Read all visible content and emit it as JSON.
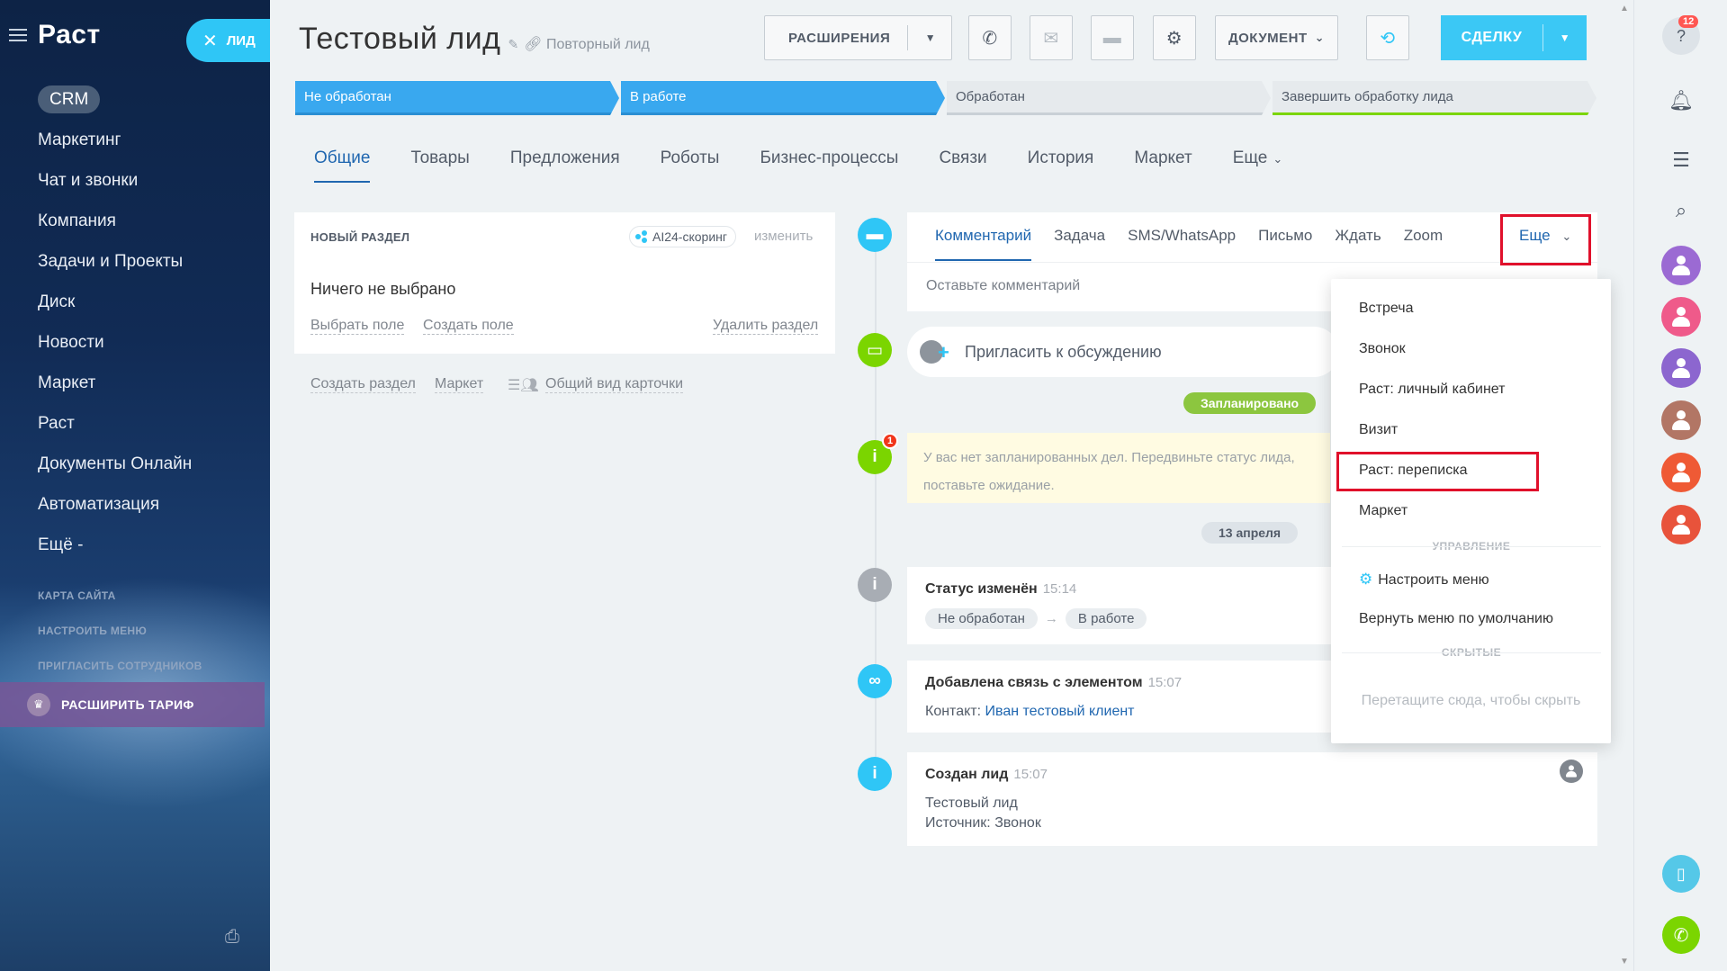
{
  "sidebar": {
    "brand": "Раст",
    "items": [
      {
        "label": "CRM"
      },
      {
        "label": "Маркетинг"
      },
      {
        "label": "Чат и звонки"
      },
      {
        "label": "Компания"
      },
      {
        "label": "Задачи и Проекты"
      },
      {
        "label": "Диск"
      },
      {
        "label": "Новости"
      },
      {
        "label": "Маркет"
      },
      {
        "label": "Раст"
      },
      {
        "label": "Документы Онлайн"
      },
      {
        "label": "Автоматизация"
      },
      {
        "label": "Ещё -"
      }
    ],
    "site_map": "КАРТА САЙТА",
    "setup_menu": "НАСТРОИТЬ МЕНЮ",
    "invite": "ПРИГЛАСИТЬ СОТРУДНИКОВ",
    "upgrade": "РАСШИРИТЬ ТАРИФ"
  },
  "close_tab": {
    "label": "ЛИД"
  },
  "header": {
    "title": "Тестовый лид",
    "repeat_label": "Повторный лид",
    "extensions": "РАСШИРЕНИЯ",
    "document": "ДОКУМЕНТ",
    "deal": "СДЕЛКУ"
  },
  "stages": [
    {
      "label": "Не обработан"
    },
    {
      "label": "В работе"
    },
    {
      "label": "Обработан"
    },
    {
      "label": "Завершить обработку лида"
    }
  ],
  "tabs": [
    {
      "label": "Общие"
    },
    {
      "label": "Товары"
    },
    {
      "label": "Предложения"
    },
    {
      "label": "Роботы"
    },
    {
      "label": "Бизнес-процессы"
    },
    {
      "label": "Связи"
    },
    {
      "label": "История"
    },
    {
      "label": "Маркет"
    },
    {
      "label": "Еще"
    }
  ],
  "card": {
    "heading": "НОВЫЙ РАЗДЕЛ",
    "ai_chip": "AI24-скоринг",
    "edit": "изменить",
    "empty": "Ничего не выбрано",
    "select_field": "Выбрать поле",
    "create_field": "Создать поле",
    "delete_section": "Удалить раздел"
  },
  "below_card": {
    "create_section": "Создать раздел",
    "market": "Маркет",
    "card_view": "Общий вид карточки"
  },
  "editor": {
    "tabs": [
      "Комментарий",
      "Задача",
      "SMS/WhatsApp",
      "Письмо",
      "Ждать",
      "Zoom"
    ],
    "more": "Еще",
    "placeholder": "Оставьте комментарий"
  },
  "invite": {
    "label": "Пригласить к обсуждению"
  },
  "timeline": {
    "scheduled": "Запланировано",
    "warning_line1": "У вас нет запланированных дел. Передвиньте статус лида,",
    "warning_line2": "поставьте ожидание.",
    "warning_count": "1",
    "date": "13 апреля",
    "status": {
      "title": "Статус изменён",
      "time": "15:14",
      "from": "Не обработан",
      "to": "В работе"
    },
    "link": {
      "title": "Добавлена связь с элементом",
      "time": "15:07",
      "prefix": "Контакт:",
      "contact": "Иван тестовый клиент"
    },
    "created": {
      "title": "Создан лид",
      "time": "15:07",
      "line1": "Тестовый лид",
      "line2": "Источник: Звонок"
    }
  },
  "dropdown": {
    "items": [
      "Встреча",
      "Звонок",
      "Раст: личный кабинет",
      "Визит",
      "Раст: переписка",
      "Маркет"
    ],
    "section_manage": "УПРАВЛЕНИЕ",
    "configure": "Настроить меню",
    "reset": "Вернуть меню по умолчанию",
    "section_hidden": "СКРЫТЫЕ",
    "drop_hint": "Перетащите сюда, чтобы скрыть"
  },
  "rail": {
    "help_badge": "12"
  },
  "colors": {
    "accent": "#2fc6f6",
    "stage_blue": "#39a8ef",
    "link": "#2067b0",
    "green": "#7bd500",
    "highlight_red": "#e0102b",
    "avatars": [
      "#9b6ad3",
      "#ef5a8a",
      "#8c66cf",
      "#b27665",
      "#ef5a35",
      "#e8533b"
    ]
  }
}
